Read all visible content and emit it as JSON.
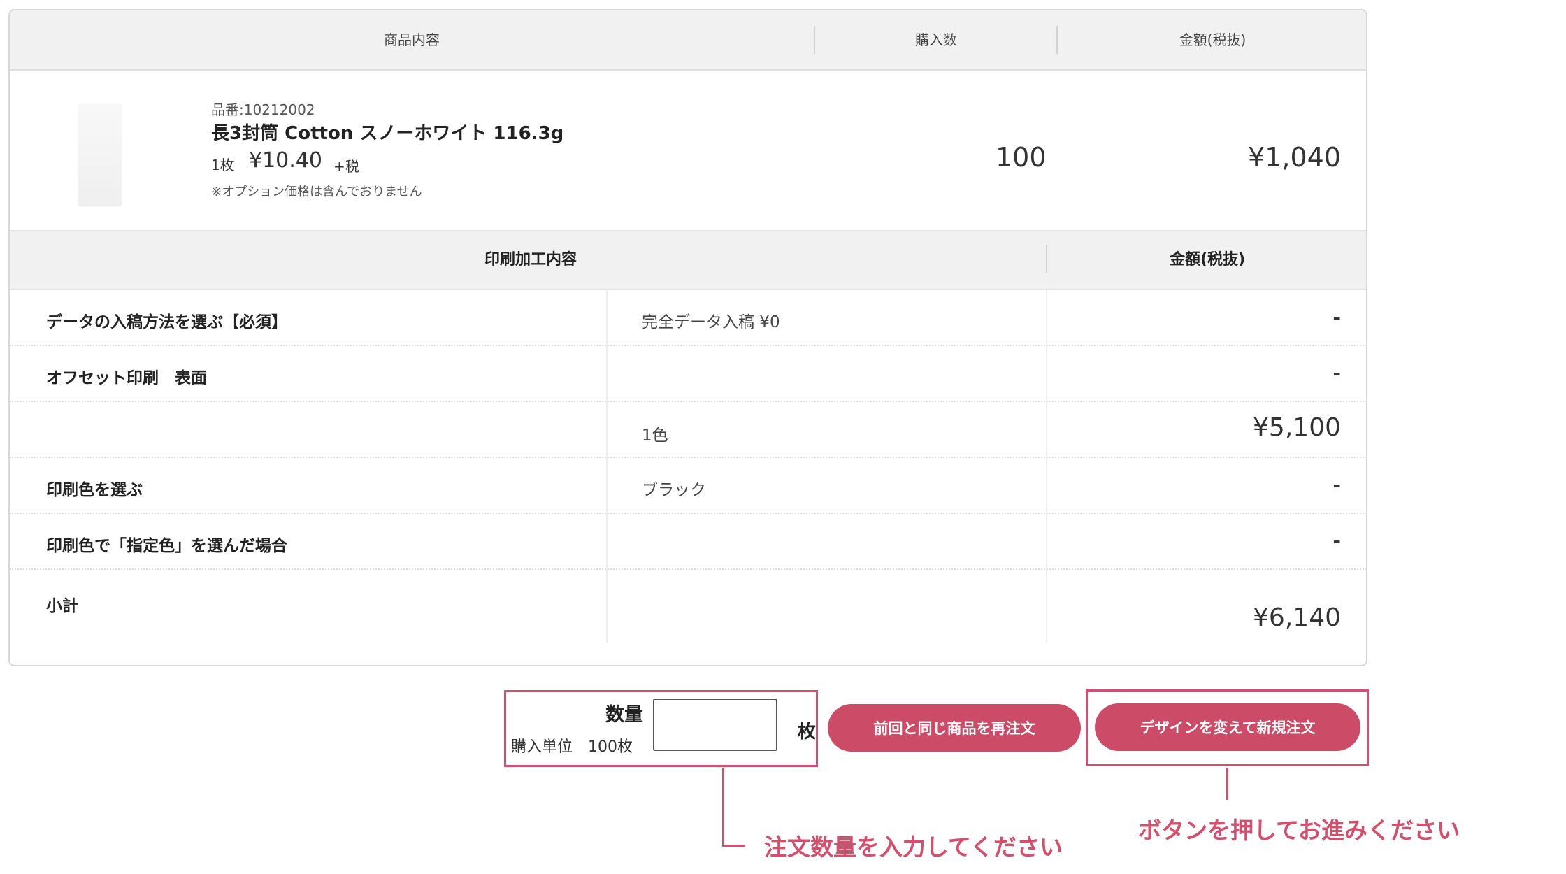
{
  "header": {
    "col_product": "商品内容",
    "col_quantity": "購入数",
    "col_amount": "金額(税抜)"
  },
  "product": {
    "code": "品番:10212002",
    "name": "長3封筒 Cotton スノーホワイト 116.3g",
    "unit_label": "1枚",
    "unit_price": "¥10.40",
    "tax_note": "+税",
    "option_note": "※オプション価格は含んでおりません",
    "quantity": "100",
    "amount": "¥1,040"
  },
  "print_header": {
    "title": "印刷加工内容",
    "amount": "金額(税抜)"
  },
  "print_rows": [
    {
      "label": "データの入稿方法を選ぶ【必須】",
      "value": "完全データ入稿 ¥0",
      "amount": "-"
    },
    {
      "label": "オフセット印刷　表面",
      "value": "",
      "amount": "-"
    },
    {
      "label": "",
      "value": "1色",
      "amount": "¥5,100"
    },
    {
      "label": "印刷色を選ぶ",
      "value": "ブラック",
      "amount": "-"
    },
    {
      "label": "印刷色で「指定色」を選んだ場合",
      "value": "",
      "amount": "-"
    }
  ],
  "subtotal": {
    "label": "小計",
    "amount": "¥6,140"
  },
  "order": {
    "qty_label": "数量",
    "unit_note": "購入単位　100枚",
    "qty_value": "",
    "qty_suffix": "枚",
    "reorder_button": "前回と同じ商品を再注文",
    "new_order_button": "デザインを変えて新規注文"
  },
  "annotations": {
    "qty_hint": "注文数量を入力してください",
    "button_hint": "ボタンを押してお進みください"
  },
  "colors": {
    "accent": "#d2506d",
    "button": "#cc4b67",
    "header_bg": "#f1f1f1"
  }
}
